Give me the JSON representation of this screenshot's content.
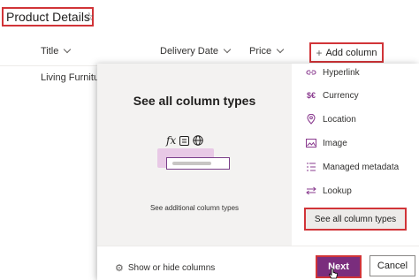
{
  "header": {
    "title": "Product Details",
    "favorite_icon": "star-outline-icon"
  },
  "list": {
    "columns": [
      {
        "label": "Title"
      },
      {
        "label": "Delivery Date"
      },
      {
        "label": "Price"
      }
    ],
    "add_column_label": "Add column",
    "rows": [
      {
        "title": "Living Furniture"
      }
    ]
  },
  "panel": {
    "preview_title": "See all column types",
    "preview_link": "See additional column types",
    "preview_icons": [
      "function-icon",
      "choice-icon",
      "globe-icon"
    ],
    "types": [
      {
        "label": "Hyperlink",
        "icon": "link-icon"
      },
      {
        "label": "Currency",
        "icon": "currency-icon"
      },
      {
        "label": "Location",
        "icon": "location-pin-icon"
      },
      {
        "label": "Image",
        "icon": "image-icon"
      },
      {
        "label": "Managed metadata",
        "icon": "managed-metadata-icon"
      },
      {
        "label": "Lookup",
        "icon": "lookup-icon"
      }
    ],
    "see_all_label": "See all column types",
    "show_hide_label": "Show or hide columns",
    "next_label": "Next",
    "cancel_label": "Cancel"
  },
  "colors": {
    "accent": "#7a2d7d",
    "highlight_border": "#d13438",
    "icon_tint": "#8a3b8f"
  }
}
